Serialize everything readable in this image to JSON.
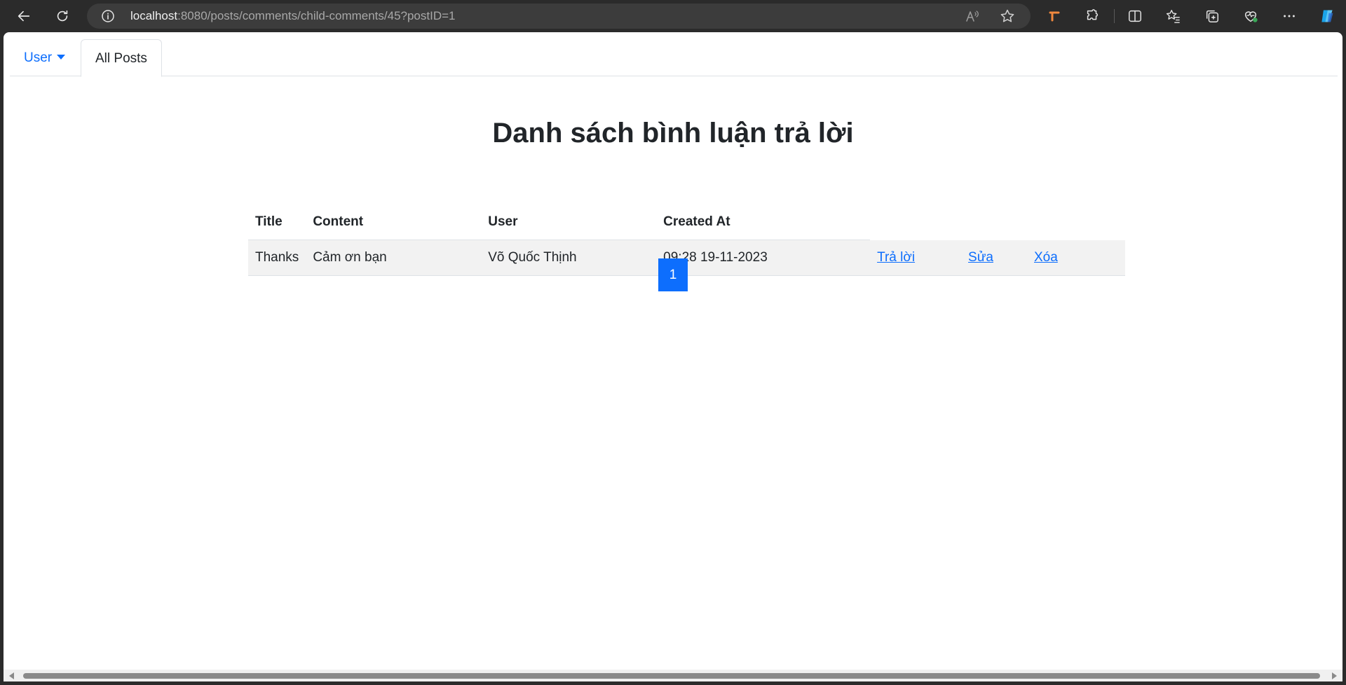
{
  "browser": {
    "url_host": "localhost",
    "url_rest": ":8080/posts/comments/child-comments/45?postID=1",
    "icons": [
      "back-icon",
      "refresh-icon",
      "info-icon",
      "read-aloud-icon",
      "favorite-star-icon",
      "extension-orange-icon",
      "extensions-icon",
      "split-screen-icon",
      "favorites-icon",
      "collections-icon",
      "browser-essentials-icon",
      "more-icon",
      "copilot-icon"
    ]
  },
  "nav": {
    "user_label": "User",
    "all_posts_label": "All Posts"
  },
  "page": {
    "title": "Danh sách bình luận trả lời"
  },
  "table": {
    "headers": {
      "title": "Title",
      "content": "Content",
      "user": "User",
      "created_at": "Created At"
    },
    "rows": [
      {
        "title": "Thanks",
        "content": "Cảm ơn bạn",
        "user": "Võ Quốc Thịnh",
        "created_at": "09:28 19-11-2023",
        "reply_label": "Trả lời",
        "edit_label": "Sửa",
        "delete_label": "Xóa"
      }
    ]
  },
  "pagination": {
    "current_page": "1"
  },
  "colors": {
    "accent": "#0d6efd",
    "chrome_bg": "#2b2b2b",
    "row_bg": "#f2f2f2"
  }
}
